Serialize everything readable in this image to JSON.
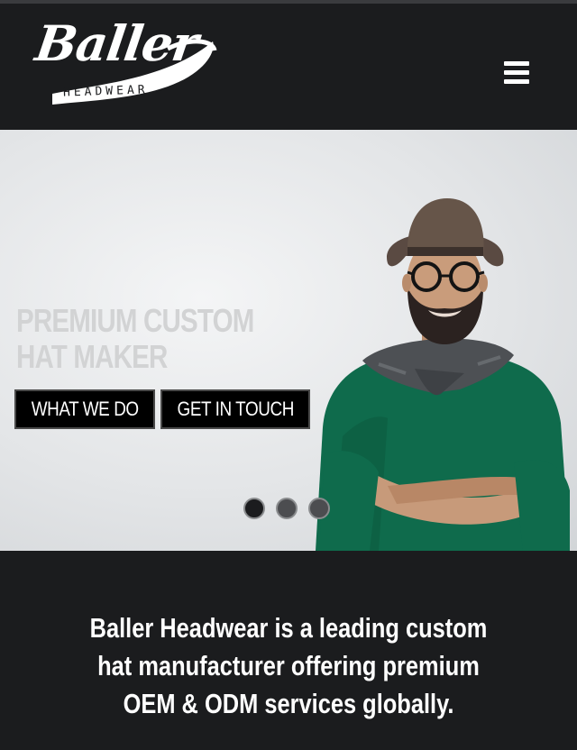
{
  "header": {
    "logo": {
      "script_text": "Baller",
      "sub_text": "HEADWEAR"
    },
    "menu_icon": "hamburger-menu-icon"
  },
  "hero": {
    "title_line1": "PREMIUM CUSTOM",
    "title_line2": "HAT MAKER",
    "buttons": {
      "what_we_do": "WHAT WE DO",
      "get_in_touch": "GET IN TOUCH"
    },
    "carousel": {
      "slide_count": 3,
      "active_index": 0
    }
  },
  "tagline": {
    "text": "Baller Headwear is a leading custom hat manufacturer offering premium OEM & ODM services globally."
  },
  "colors": {
    "header_bg": "#1b1c1e",
    "button_bg": "#000000",
    "text_white": "#ffffff",
    "sweater_green": "#0f6b4c",
    "hat_brown": "#5a4a42"
  }
}
